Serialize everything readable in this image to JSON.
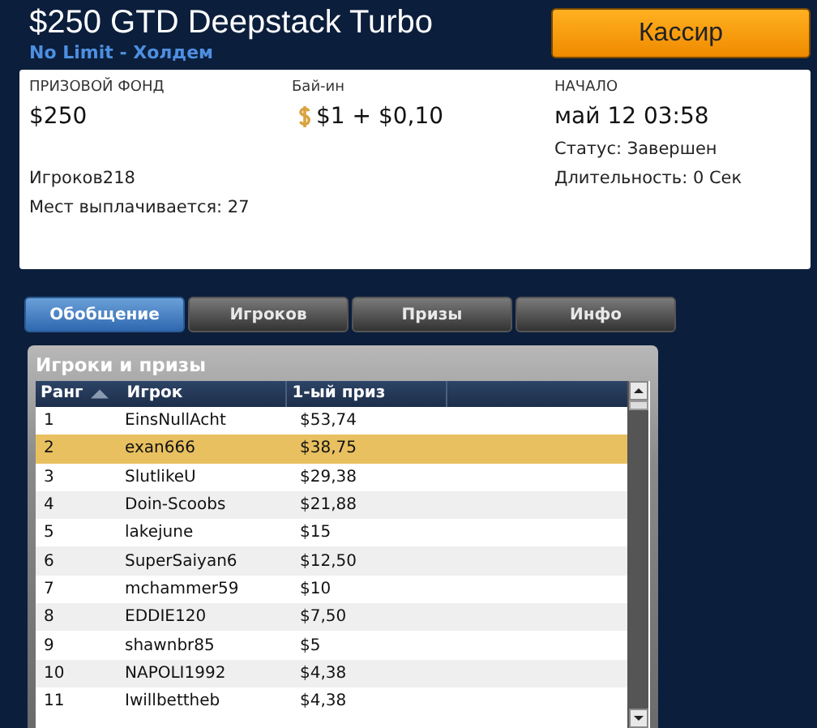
{
  "header": {
    "title": "$250 GTD Deepstack Turbo",
    "subtitle": "No Limit - Холдем",
    "cashier_button": "Кассир"
  },
  "info": {
    "prize_pool": {
      "label": "ПРИЗОВОЙ ФОНД",
      "value": "$250"
    },
    "buy_in": {
      "label": "Бай-ин",
      "value": "$1 + $0,10"
    },
    "start": {
      "label": "НАЧАЛО",
      "value": "май 12 03:58"
    },
    "status": "Статус: Завершен",
    "duration": "Длительность: 0 Сек",
    "players": "Игроков218",
    "paid_places": "Мест выплачивается: 27"
  },
  "tabs": [
    {
      "label": "Обобщение",
      "selected": true
    },
    {
      "label": "Игроков",
      "selected": false
    },
    {
      "label": "Призы",
      "selected": false
    },
    {
      "label": "Инфо",
      "selected": false
    }
  ],
  "panel": {
    "title": "Игроки и призы",
    "columns": [
      "Ранг",
      "Игрок",
      "1-ый приз"
    ],
    "rows": [
      {
        "rank": "1",
        "player": "EinsNullAcht",
        "prize": "$53,74",
        "selected": false
      },
      {
        "rank": "2",
        "player": "exan666",
        "prize": "$38,75",
        "selected": true
      },
      {
        "rank": "3",
        "player": "SlutlikeU",
        "prize": "$29,38",
        "selected": false
      },
      {
        "rank": "4",
        "player": "Doin-Scoobs",
        "prize": "$21,88",
        "selected": false
      },
      {
        "rank": "5",
        "player": "lakejune",
        "prize": "$15",
        "selected": false
      },
      {
        "rank": "6",
        "player": "SuperSaiyan6",
        "prize": "$12,50",
        "selected": false
      },
      {
        "rank": "7",
        "player": "mchammer59",
        "prize": "$10",
        "selected": false
      },
      {
        "rank": "8",
        "player": "EDDIE120",
        "prize": "$7,50",
        "selected": false
      },
      {
        "rank": "9",
        "player": "shawnbr85",
        "prize": "$5",
        "selected": false
      },
      {
        "rank": "10",
        "player": "NAPOLI1992",
        "prize": "$4,38",
        "selected": false
      },
      {
        "rank": "11",
        "player": "Iwillbettheb",
        "prize": "$4,38",
        "selected": false
      }
    ]
  }
}
